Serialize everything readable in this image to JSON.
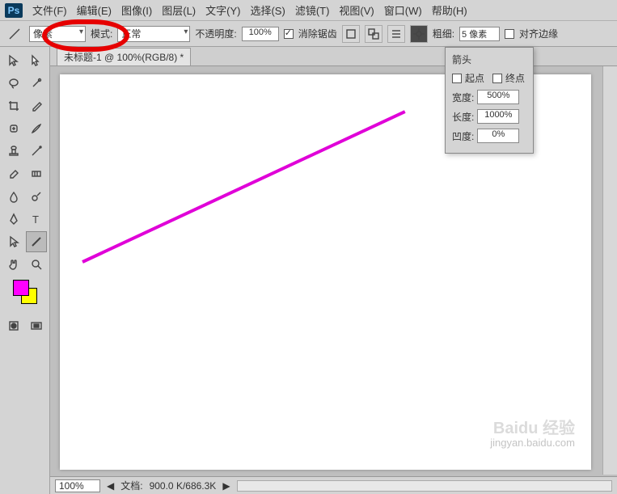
{
  "menu": {
    "items": [
      "文件(F)",
      "编辑(E)",
      "图像(I)",
      "图层(L)",
      "文字(Y)",
      "选择(S)",
      "滤镜(T)",
      "视图(V)",
      "窗口(W)",
      "帮助(H)"
    ]
  },
  "optbar": {
    "preset_value": "像素",
    "mode_label": "模式:",
    "mode_value": "正常",
    "opacity_label": "不透明度:",
    "opacity_value": "100%",
    "antialias_label": "消除锯齿",
    "stroke_label": "粗细:",
    "stroke_value": "5 像素",
    "align_label": "对齐边缘"
  },
  "doc": {
    "tab_title": "未标题-1 @ 100%(RGB/8) *",
    "zoom": "100%",
    "status_label": "文档:",
    "status_value": "900.0 K/686.3K"
  },
  "arrow_panel": {
    "title": "箭头",
    "start_label": "起点",
    "end_label": "终点",
    "width_label": "宽度:",
    "width_value": "500%",
    "length_label": "长度:",
    "length_value": "1000%",
    "concavity_label": "凹度:",
    "concavity_value": "0%"
  },
  "watermark": {
    "brand": "Baidu 经验",
    "url": "jingyan.baidu.com"
  },
  "colors": {
    "foreground": "#ff00ff",
    "background": "#ffff00",
    "line": "#e000d8"
  }
}
